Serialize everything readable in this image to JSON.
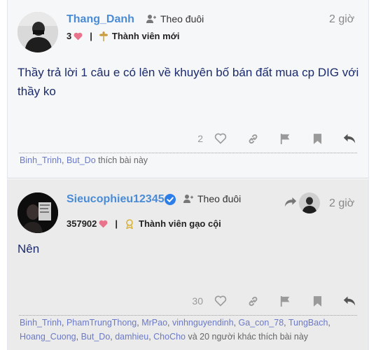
{
  "post1": {
    "username": "Thang_Danh",
    "follow_label": "Theo đuôi",
    "time": "2 giờ",
    "likes": "3",
    "rank": "Thành viên mới",
    "body": "Thầy trả lời 1 câu e có lên về khuyên bố bán đất mua cp DIG với thầy ko",
    "like_count": "2",
    "likers": [
      "Binh_Trinh",
      "But_Do"
    ],
    "likers_suffix": "thích bài này"
  },
  "post2": {
    "username": "Sieucophieu12345",
    "follow_label": "Theo đuôi",
    "time": "2 giờ",
    "likes": "357902",
    "rank": "Thành viên gạo cội",
    "body": "Nên",
    "like_count": "30",
    "likers": [
      "Binh_Trinh",
      "PhamTrungThong",
      "MrPao",
      "vinhnguyendinh",
      "Ga_con_78",
      "TungBach",
      "Hoang_Cuong",
      "But_Do",
      "damhieu",
      "ChoCho"
    ],
    "likers_suffix": "và 20 người khác thích bài này"
  },
  "colors": {
    "link": "#4a8bd6",
    "heart": "#e8738a",
    "body_text": "#1a2a6b",
    "verified": "#2d7ee8"
  }
}
